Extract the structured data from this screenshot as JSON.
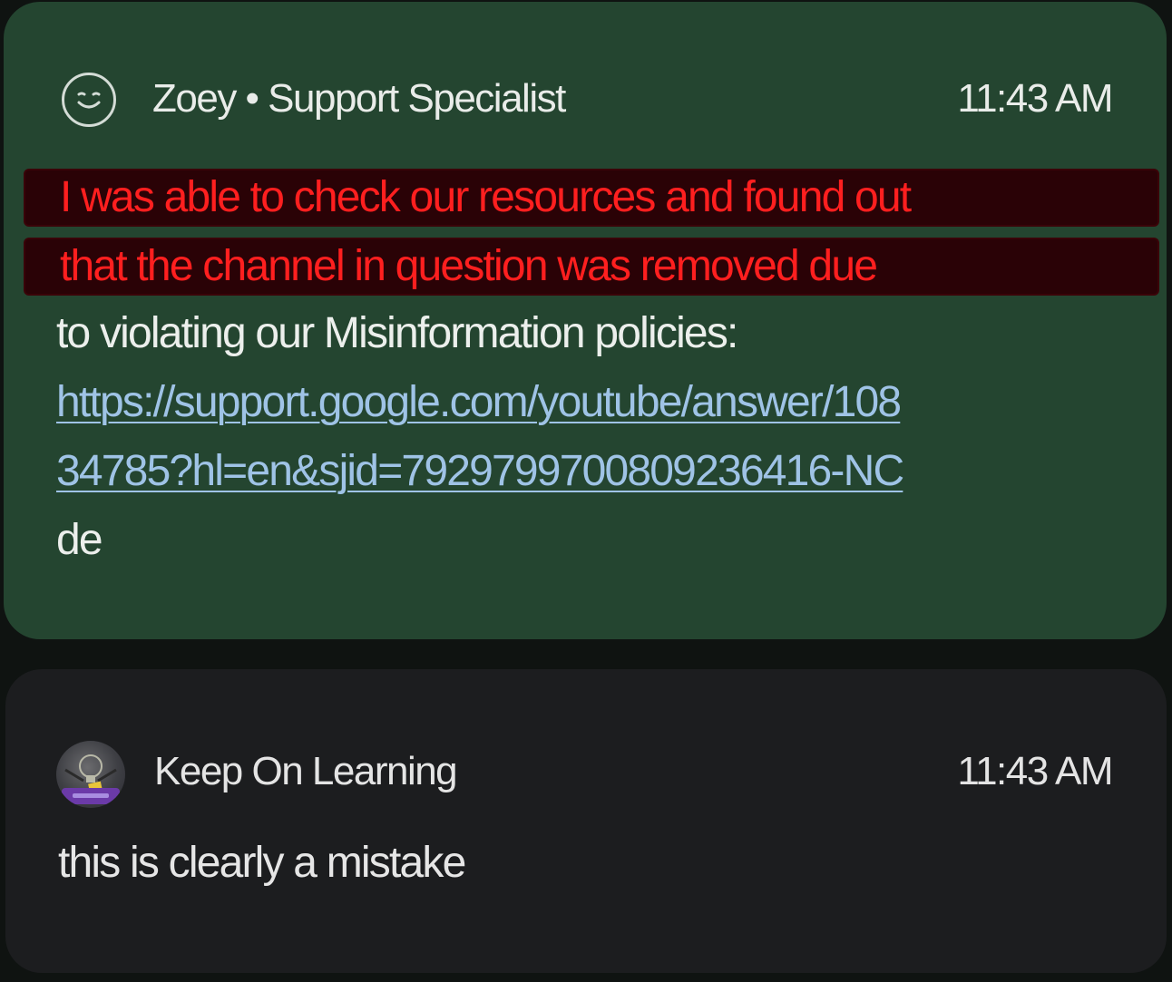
{
  "messages": [
    {
      "author": "Zoey • Support Specialist",
      "time": "11:43 AM",
      "lines": {
        "l1": "I was able to check our resources and found out",
        "l2": "that the channel in question was removed due",
        "l3": "to violating our Misinformation policies:",
        "l4": "https://support.google.com/youtube/answer/108",
        "l5": "34785?hl=en&sjid=7929799700809236416-NC",
        "l6": "de"
      },
      "highlight_color": "#ff1f1f",
      "bubble_color": "#244530",
      "avatar_icon": "smiley-face-icon"
    },
    {
      "author": "Keep On Learning",
      "time": "11:43 AM",
      "text": "this is clearly a mistake",
      "bubble_color": "#1c1d1f",
      "avatar_icon": "channel-avatar-image"
    }
  ]
}
